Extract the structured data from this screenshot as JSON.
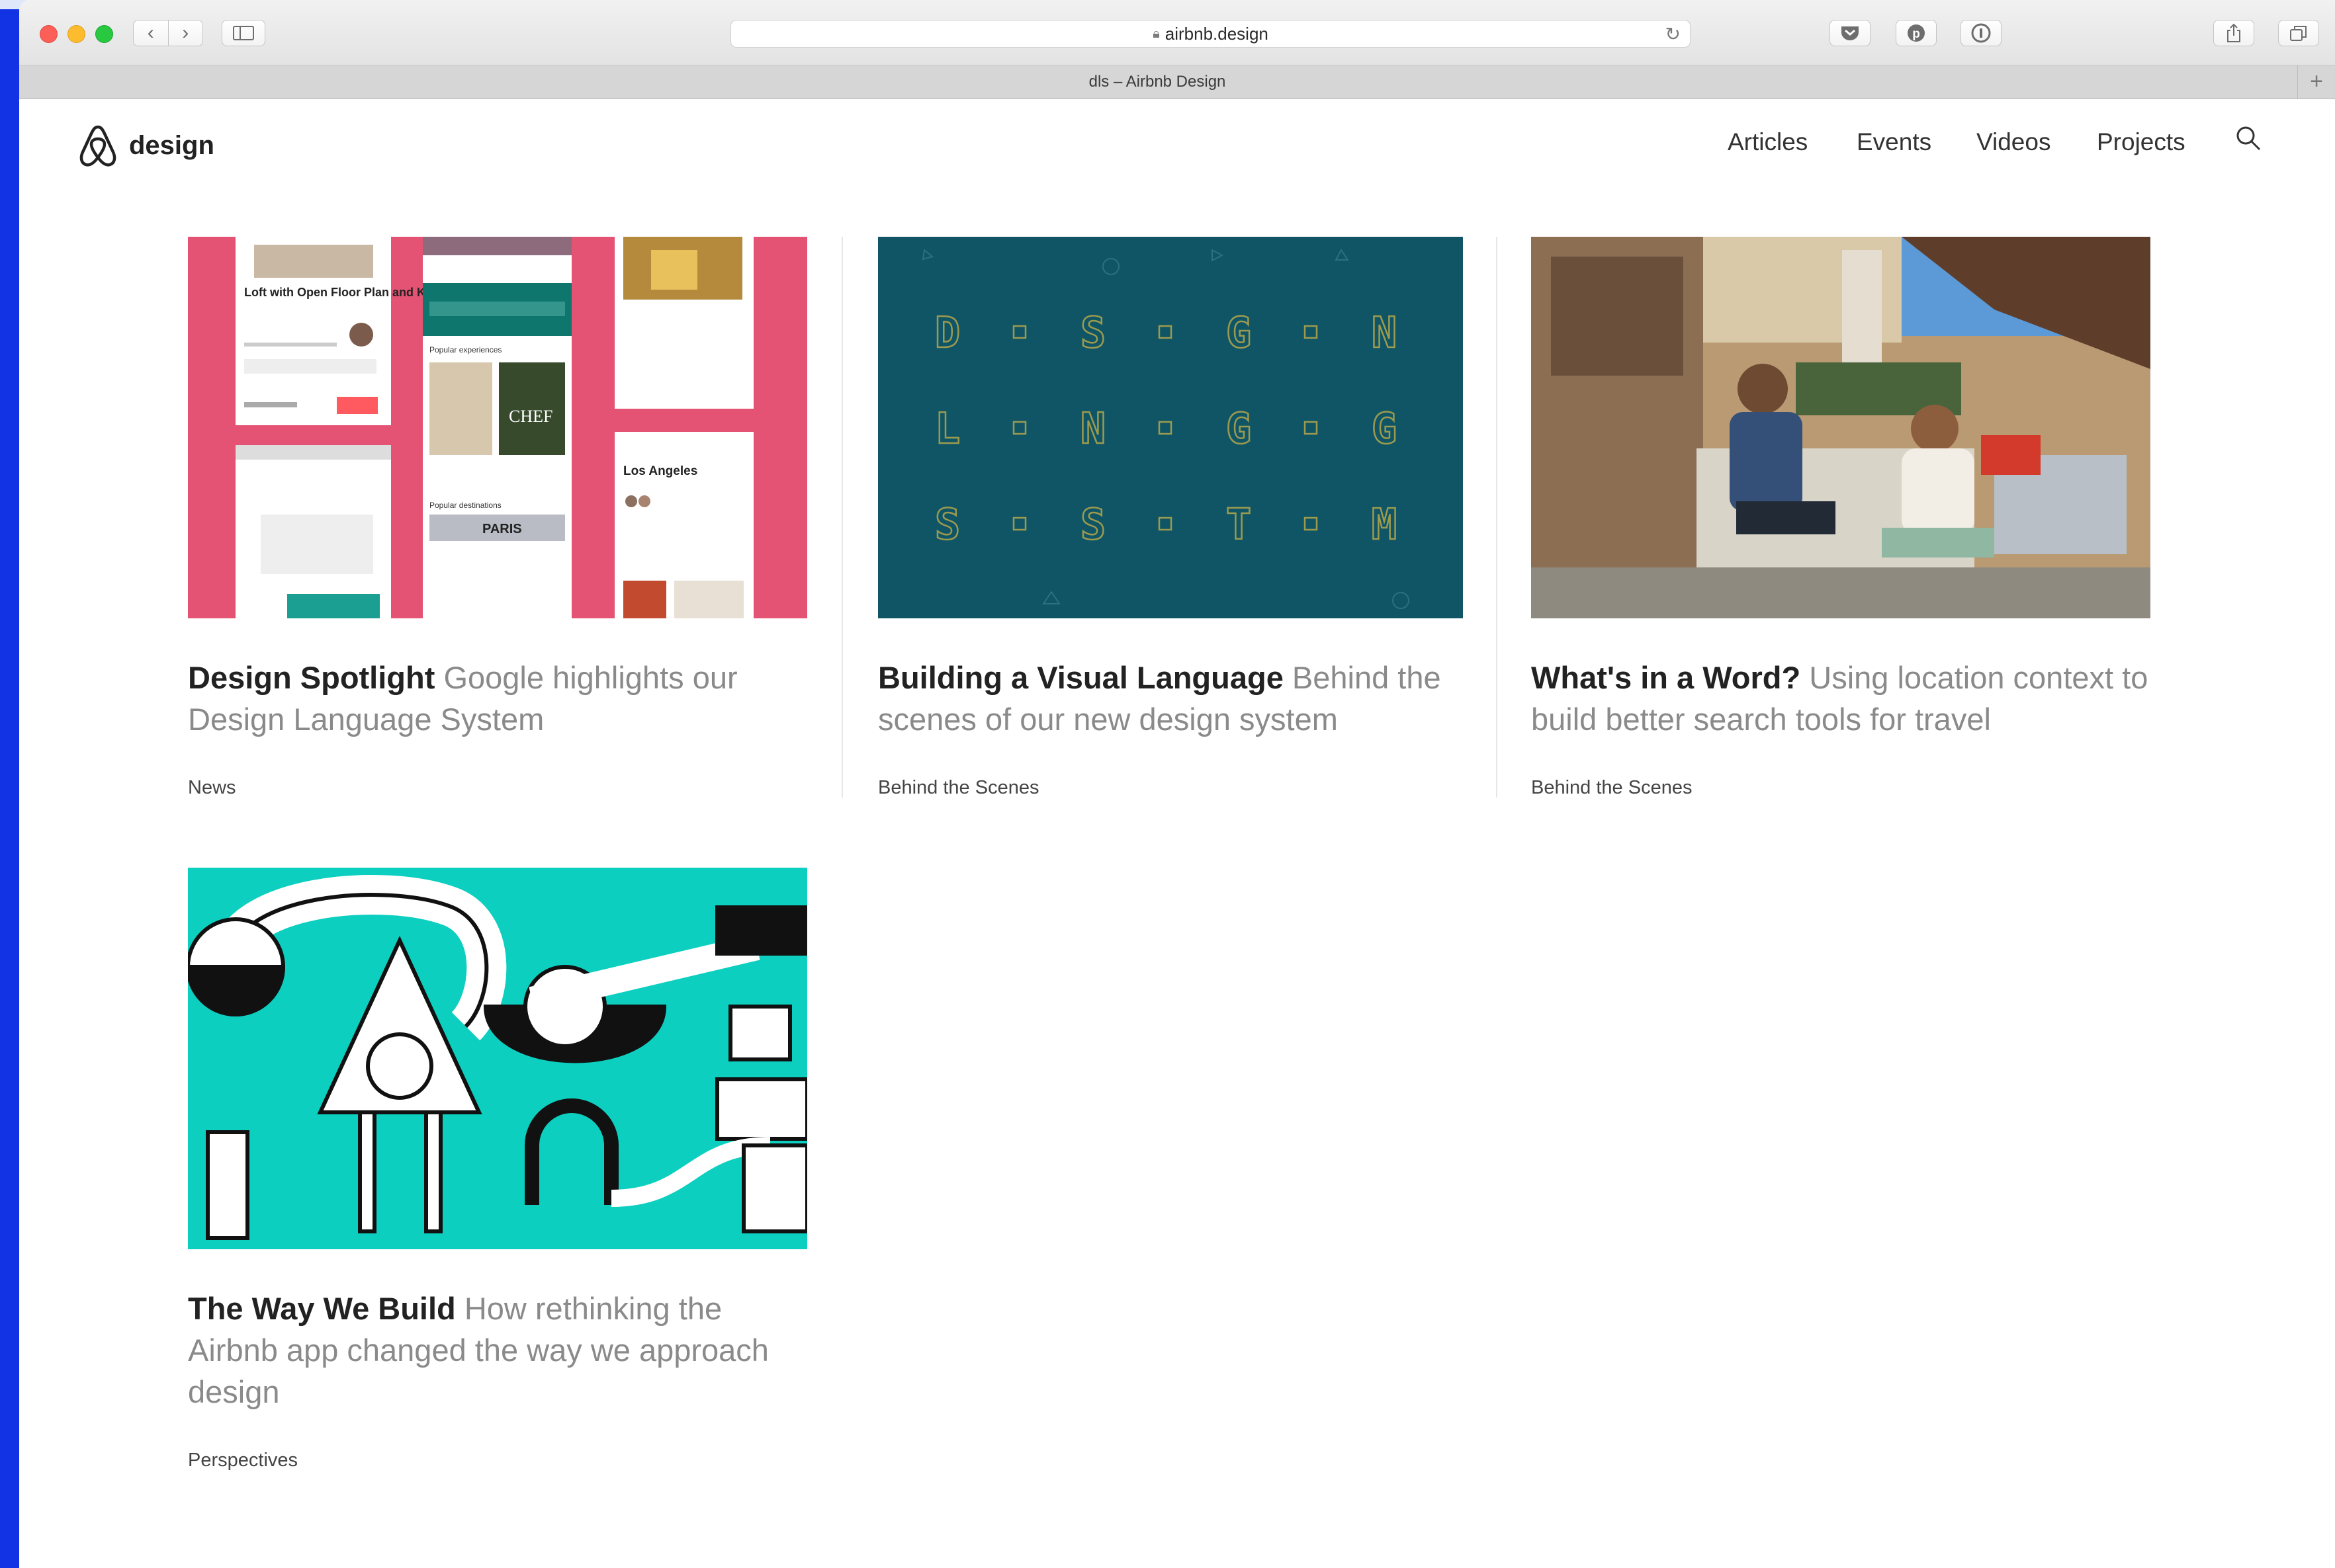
{
  "browser": {
    "url": "airbnb.design",
    "tab_title": "dls – Airbnb Design",
    "back": "‹",
    "forward": "›",
    "new_tab": "+"
  },
  "site": {
    "logo_text": "design",
    "nav": [
      "Articles",
      "Events",
      "Videos",
      "Projects"
    ]
  },
  "articles": [
    {
      "title": "Design Spotlight",
      "subtitle": "Google highlights our Design Language System",
      "category": "News",
      "thumb_bg": "#e45373",
      "phone_texts": [
        "Loft with Open Floor Plan and Kitchen",
        "Los Angeles",
        "Popular experiences",
        "Popular destinations",
        "PARIS"
      ]
    },
    {
      "title": "Building a Visual Language",
      "subtitle": "Behind the scenes of our new design system",
      "category": "Behind the Scenes",
      "thumb_bg": "#0f5565",
      "grid_letters": [
        [
          "D",
          "S",
          "G",
          "N"
        ],
        [
          "L",
          "N",
          "G",
          "G"
        ],
        [
          "S",
          "S",
          "T",
          "M"
        ]
      ]
    },
    {
      "title": "What's in a Word?",
      "subtitle": "Using location context to build better search tools for travel",
      "category": "Behind the Scenes",
      "thumb_bg": "#9aa6b0"
    },
    {
      "title": "The Way We Build",
      "subtitle": "How rethinking the Airbnb app changed the way we approach design",
      "category": "Perspectives",
      "thumb_bg": "#0ccfc0"
    }
  ]
}
